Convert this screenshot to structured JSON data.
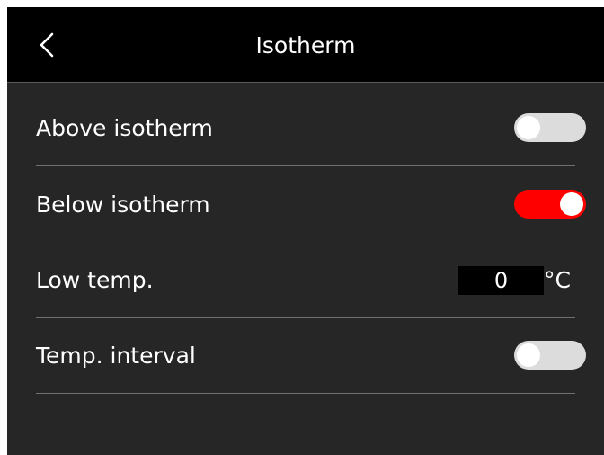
{
  "header": {
    "title": "Isotherm",
    "back_icon": "chevron-left-icon"
  },
  "settings": {
    "above_isotherm": {
      "label": "Above isotherm",
      "enabled": false
    },
    "below_isotherm": {
      "label": "Below isotherm",
      "enabled": true
    },
    "low_temp": {
      "label": "Low temp.",
      "value": "0",
      "unit": "°C"
    },
    "temp_interval": {
      "label": "Temp. interval",
      "enabled": false
    }
  },
  "colors": {
    "accent_on": "#ff0000",
    "toggle_off": "#dcdcdc",
    "background": "#262626",
    "header_background": "#000000"
  }
}
